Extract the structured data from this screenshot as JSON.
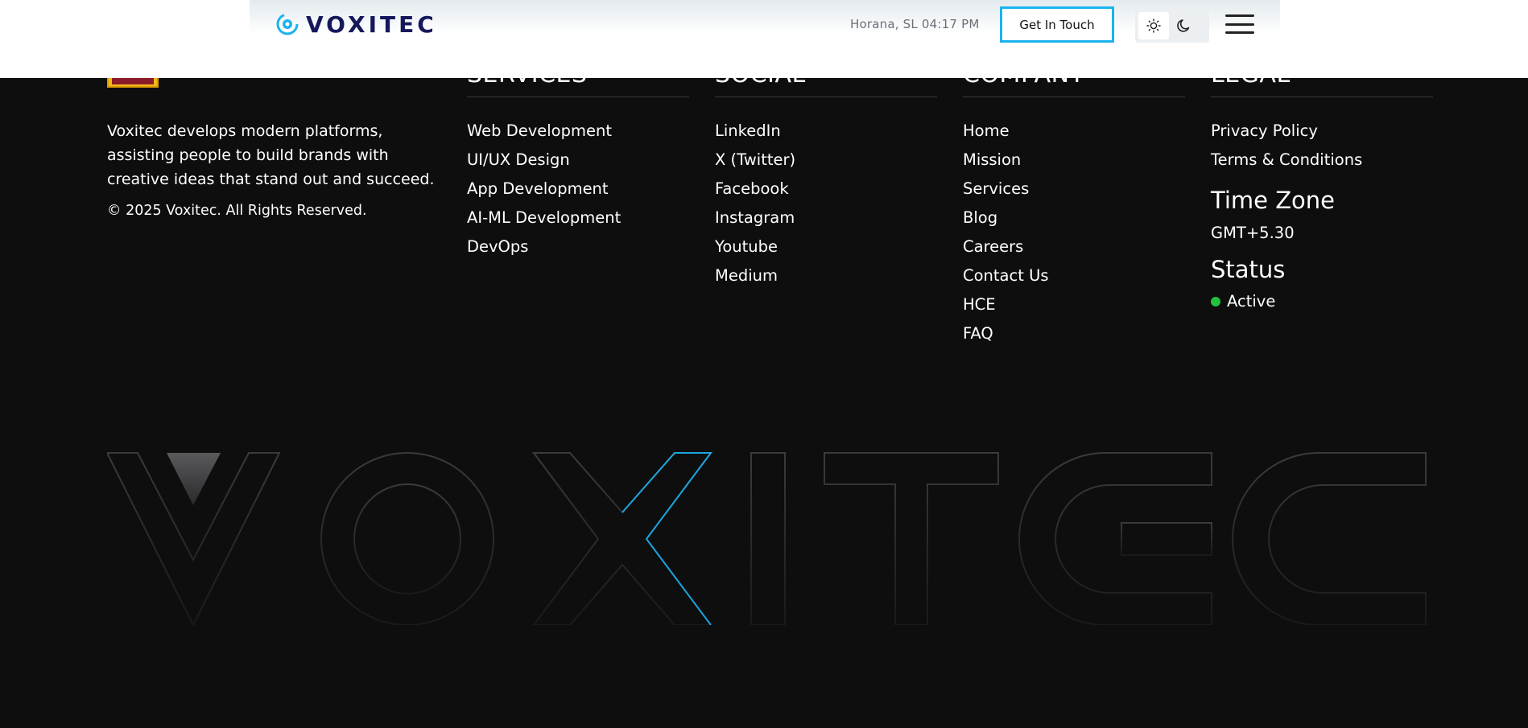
{
  "navbar": {
    "brand_name": "VOXITEC",
    "location": "Horana, SL",
    "time": "04:17 PM",
    "cta_label": "Get In Touch",
    "accent_color": "#1ab3f0",
    "brand_color": "#15185a",
    "theme_icons": [
      "sun-icon",
      "moon-icon"
    ],
    "menu_icon": "hamburger-menu-icon"
  },
  "footer": {
    "about_text": "Voxitec develops modern platforms, assisting people to build brands with creative ideas that stand out and succeed.",
    "copyright": "© 2025 Voxitec. All Rights Reserved.",
    "services": {
      "title": "SERVICES",
      "items": [
        "Web Development",
        "UI/UX Design",
        "App Development",
        "AI-ML Development",
        "DevOps"
      ]
    },
    "social": {
      "title": "SOCIAL",
      "items": [
        "LinkedIn",
        "X (Twitter)",
        "Facebook",
        "Instagram",
        "Youtube",
        "Medium"
      ]
    },
    "company": {
      "title": "COMPANY",
      "items": [
        "Home",
        "Mission",
        "Services",
        "Blog",
        "Careers",
        "Contact Us",
        "HCE",
        "FAQ"
      ]
    },
    "legal": {
      "title": "LEGAL",
      "items": [
        "Privacy Policy",
        "Terms & Conditions"
      ],
      "timezone_title": "Time Zone",
      "timezone_value": "GMT+5.30",
      "status_title": "Status",
      "status_value": "Active",
      "status_color": "#22c33b"
    },
    "watermark_text": "VOXITEC"
  }
}
